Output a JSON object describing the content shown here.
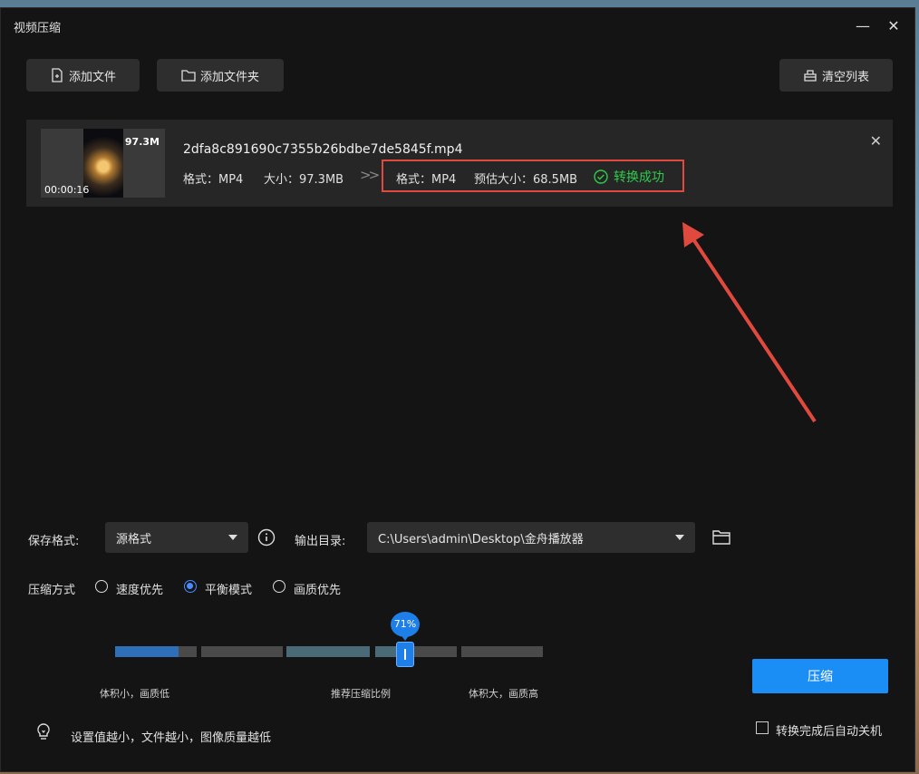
{
  "window": {
    "title": "视频压缩"
  },
  "toolbar": {
    "add_file": "添加文件",
    "add_folder": "添加文件夹",
    "clear_list": "清空列表"
  },
  "file": {
    "thumb_size": "97.3M",
    "duration": "00:00:16",
    "name": "2dfa8c891690c7355b26bdbe7de5845f.mp4",
    "source_format": "格式：MP4",
    "source_size": "大小：97.3MB",
    "arrow": ">>",
    "target_format": "格式：MP4",
    "target_size": "预估大小：68.5MB",
    "status": "转换成功",
    "status_color": "#2ecc4b"
  },
  "settings": {
    "save_format_label": "保存格式:",
    "save_format_value": "源格式",
    "output_dir_label": "输出目录:",
    "output_dir_value": "C:\\Users\\admin\\Desktop\\金舟播放器",
    "mode_label": "压缩方式",
    "modes": [
      "速度优先",
      "平衡模式",
      "画质优先"
    ],
    "selected_mode": "平衡模式",
    "slider_value": "71%",
    "slider_fraction": 0.71,
    "hint_left": "体积小，画质低",
    "hint_mid": "推荐压缩比例",
    "hint_right": "体积大，画质高",
    "tip": "设置值越小，文件越小，图像质量越低"
  },
  "actions": {
    "compress": "压缩",
    "auto_shutdown": "转换完成后自动关机"
  },
  "colors": {
    "accent": "#1b8ef5",
    "highlight": "#e04a3e"
  }
}
